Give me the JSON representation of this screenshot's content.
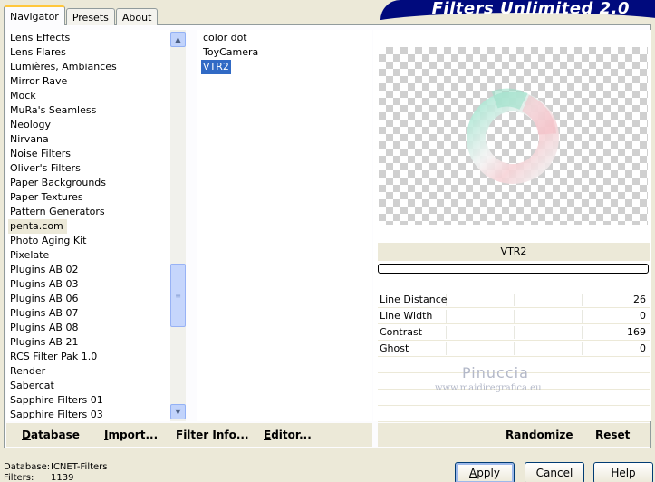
{
  "window": {
    "title": "Filters Unlimited 2.0"
  },
  "tabs": [
    {
      "label": "Navigator",
      "active": true
    },
    {
      "label": "Presets",
      "active": false
    },
    {
      "label": "About",
      "active": false
    }
  ],
  "categories": [
    "Lens Effects",
    "Lens Flares",
    "Lumières, Ambiances",
    "Mirror Rave",
    "Mock",
    "MuRa's Seamless",
    "Neology",
    "Nirvana",
    "Noise Filters",
    "Oliver's Filters",
    "Paper Backgrounds",
    "Paper Textures",
    "Pattern Generators",
    "penta.com",
    "Photo Aging Kit",
    "Pixelate",
    "Plugins AB 02",
    "Plugins AB 03",
    "Plugins AB 06",
    "Plugins AB 07",
    "Plugins AB 08",
    "Plugins AB 21",
    "RCS Filter Pak 1.0",
    "Render",
    "Sabercat",
    "Sapphire Filters 01",
    "Sapphire Filters 03"
  ],
  "selected_category": "penta.com",
  "filters": [
    "color dot",
    "ToyCamera",
    "VTR2"
  ],
  "selected_filter": "VTR2",
  "filter_name": "VTR2",
  "params": [
    {
      "name": "Line Distance",
      "value": "26"
    },
    {
      "name": "Line Width",
      "value": "0"
    },
    {
      "name": "Contrast",
      "value": "169"
    },
    {
      "name": "Ghost",
      "value": "0"
    }
  ],
  "watermark": {
    "line1": "Pinuccia",
    "line2": "www.maidiregrafica.eu"
  },
  "left_buttons": [
    {
      "label": "Database",
      "underline": "D",
      "rest": "atabase"
    },
    {
      "label": "Import...",
      "underline": "I",
      "rest": "mport..."
    },
    {
      "label": "Filter Info...",
      "underline": "",
      "rest": "Filter Info..."
    },
    {
      "label": "Editor...",
      "underline": "E",
      "rest": "ditor..."
    }
  ],
  "right_buttons": [
    {
      "label": "Randomize"
    },
    {
      "label": "Reset"
    }
  ],
  "status": {
    "database_label": "Database:",
    "database_value": "ICNET-Filters",
    "filters_label": "Filters:",
    "filters_value": "1139"
  },
  "dialog_buttons": [
    {
      "label": "Apply",
      "underline": "A",
      "rest": "pply"
    },
    {
      "label": "Cancel"
    },
    {
      "label": "Help"
    }
  ]
}
